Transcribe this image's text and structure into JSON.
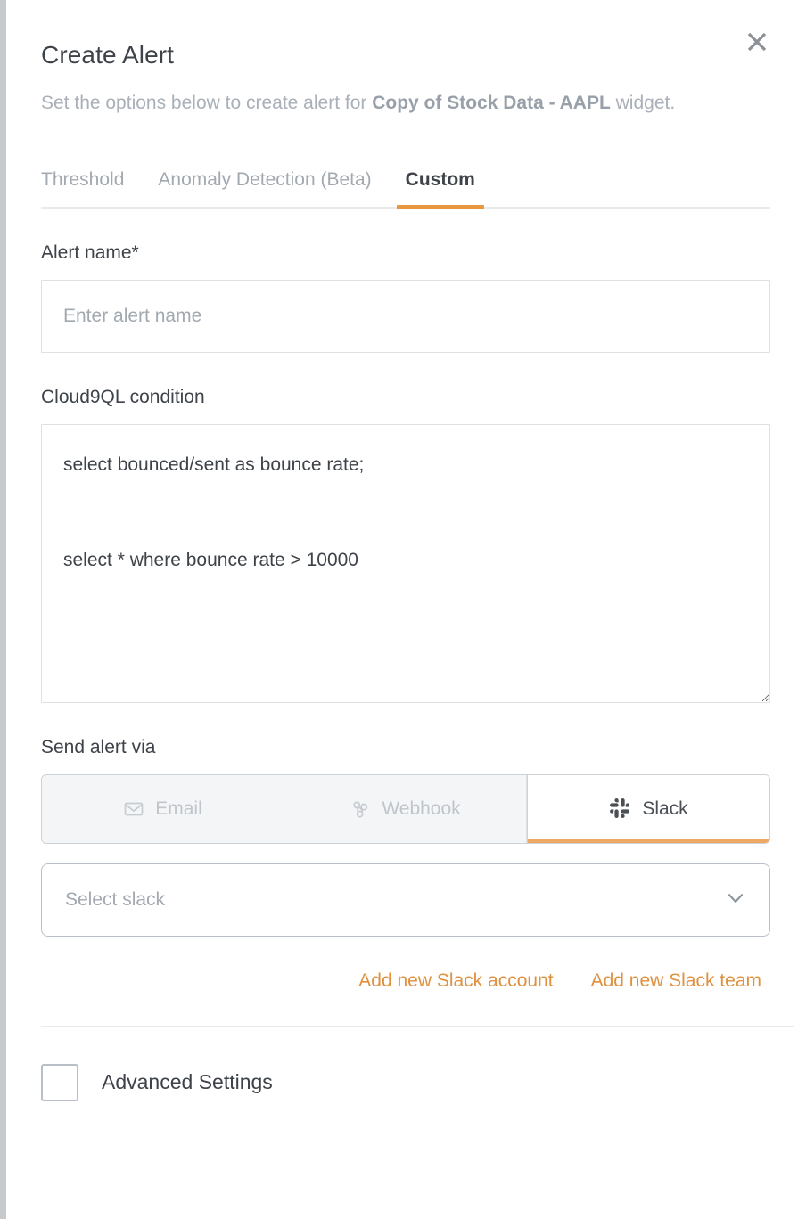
{
  "modal": {
    "title": "Create Alert",
    "subtitle_prefix": "Set the options below to create alert for ",
    "subtitle_widget": "Copy of Stock Data - AAPL",
    "subtitle_suffix": " widget.",
    "close_icon": "close-icon"
  },
  "tabs": [
    {
      "label": "Threshold",
      "active": false
    },
    {
      "label": "Anomaly Detection (Beta)",
      "active": false
    },
    {
      "label": "Custom",
      "active": true
    }
  ],
  "alert_name": {
    "label": "Alert name*",
    "placeholder": "Enter alert name",
    "value": ""
  },
  "condition": {
    "label": "Cloud9QL condition",
    "value": "select bounced/sent as bounce rate;\n\nselect * where bounce rate > 10000"
  },
  "send_via": {
    "label": "Send alert via",
    "options": [
      {
        "label": "Email",
        "icon": "envelope-icon",
        "active": false
      },
      {
        "label": "Webhook",
        "icon": "webhook-icon",
        "active": false
      },
      {
        "label": "Slack",
        "icon": "slack-icon",
        "active": true
      }
    ]
  },
  "slack_select": {
    "placeholder": "Select slack",
    "value": "",
    "chevron_icon": "chevron-down-icon"
  },
  "links": {
    "add_account": "Add new Slack account",
    "add_team": "Add new Slack team"
  },
  "advanced": {
    "label": "Advanced Settings",
    "checked": false
  },
  "colors": {
    "accent": "#e8973e",
    "link": "#e0913f",
    "text": "#3e4349",
    "muted": "#a2a9b0",
    "border": "#dfe2e5"
  }
}
